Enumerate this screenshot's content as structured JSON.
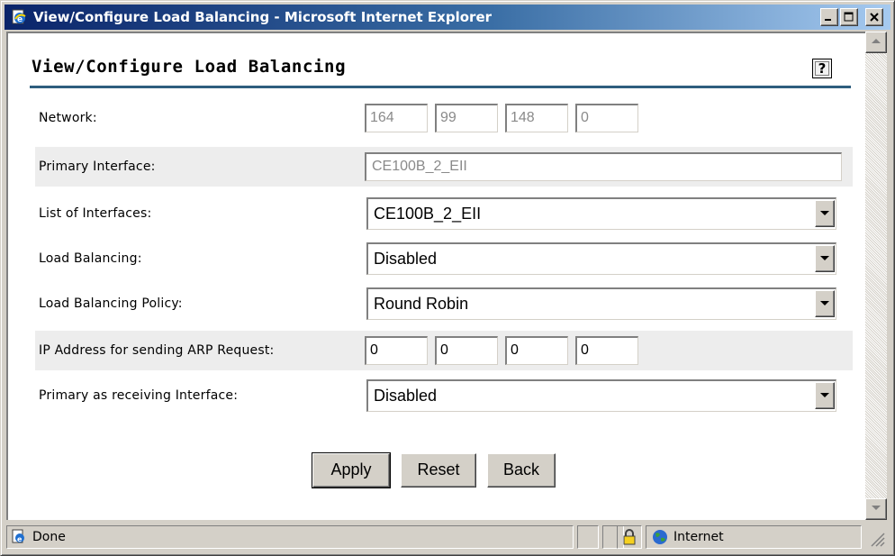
{
  "window": {
    "title": "View/Configure Load Balancing - Microsoft Internet Explorer"
  },
  "page": {
    "heading": "View/Configure Load Balancing",
    "help_label": "?"
  },
  "form": {
    "network": {
      "label": "Network:",
      "octets": [
        "164",
        "99",
        "148",
        "0"
      ]
    },
    "primary_interface": {
      "label": "Primary Interface:",
      "value": "CE100B_2_EII"
    },
    "list_of_interfaces": {
      "label": "List of Interfaces:",
      "selected": "CE100B_2_EII"
    },
    "load_balancing": {
      "label": "Load Balancing:",
      "selected": "Disabled"
    },
    "load_balancing_policy": {
      "label": "Load Balancing Policy:",
      "selected": "Round Robin"
    },
    "arp_ip": {
      "label": "IP Address for sending ARP Request:",
      "octets": [
        "0",
        "0",
        "0",
        "0"
      ]
    },
    "primary_receiving": {
      "label": "Primary as receiving Interface:",
      "selected": "Disabled"
    }
  },
  "buttons": {
    "apply": "Apply",
    "reset": "Reset",
    "back": "Back"
  },
  "statusbar": {
    "status": "Done",
    "zone": "Internet"
  },
  "icons": {
    "title": "ie-page-icon",
    "help": "help-icon",
    "status": "page-done-icon",
    "lock": "lock-icon",
    "zone": "globe-icon"
  }
}
